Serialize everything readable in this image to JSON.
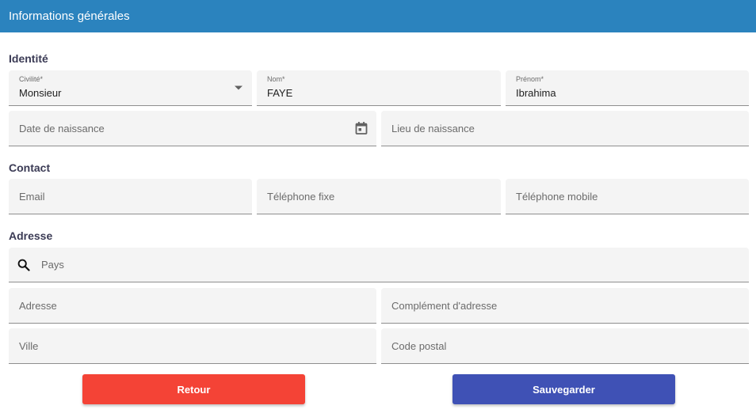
{
  "header": {
    "title": "Informations générales",
    "background": "#2b83be"
  },
  "sections": {
    "identity": "Identité",
    "contact": "Contact",
    "address": "Adresse"
  },
  "identity": {
    "civility": {
      "label": "Civilité*",
      "value": "Monsieur"
    },
    "last_name": {
      "label": "Nom*",
      "value": "FAYE"
    },
    "first_name": {
      "label": "Prénom*",
      "value": "Ibrahima"
    },
    "birth_date": {
      "placeholder": "Date de naissance"
    },
    "birth_place": {
      "placeholder": "Lieu de naissance"
    }
  },
  "contact": {
    "email": {
      "placeholder": "Email"
    },
    "landline": {
      "placeholder": "Téléphone fixe"
    },
    "mobile": {
      "placeholder": "Téléphone mobile"
    }
  },
  "address": {
    "country": {
      "placeholder": "Pays"
    },
    "street": {
      "placeholder": "Adresse"
    },
    "complement": {
      "placeholder": "Complément d'adresse"
    },
    "city": {
      "placeholder": "Ville"
    },
    "postal_code": {
      "placeholder": "Code postal"
    }
  },
  "actions": {
    "back": {
      "label": "Retour",
      "color": "#f44336"
    },
    "save": {
      "label": "Sauvegarder",
      "color": "#3f51b5"
    }
  },
  "icons": {
    "dropdown": "arrow-drop-down-icon",
    "calendar": "calendar-icon",
    "search": "search-icon"
  }
}
